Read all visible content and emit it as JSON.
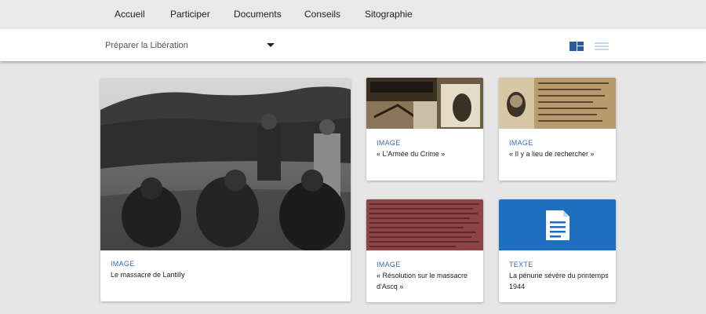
{
  "nav": {
    "items": [
      {
        "label": "Accueil"
      },
      {
        "label": "Participer"
      },
      {
        "label": "Documents"
      },
      {
        "label": "Conseils"
      },
      {
        "label": "Sitographie"
      }
    ]
  },
  "filter": {
    "selected": "Préparer la Libération"
  },
  "view_toggle": {
    "active": "grid",
    "options": [
      "grid-view-icon",
      "list-view-icon"
    ]
  },
  "cards": [
    {
      "type": "IMAGE",
      "title": "Le massacre de Lantilly"
    },
    {
      "type": "IMAGE",
      "title": "« L'Armée du Crime »"
    },
    {
      "type": "IMAGE",
      "title": "« Il y a lieu de rechercher »"
    },
    {
      "type": "IMAGE",
      "title": "« Résolution sur le massacre d'Ascq »"
    },
    {
      "type": "TEXTE",
      "title": "La pénurie sévère du printemps 1944"
    }
  ],
  "colors": {
    "accent": "#2a5aa0",
    "type_label": "#3a6ab5",
    "text_tile": "#1e6fc0",
    "background": "#e6e6e6"
  }
}
